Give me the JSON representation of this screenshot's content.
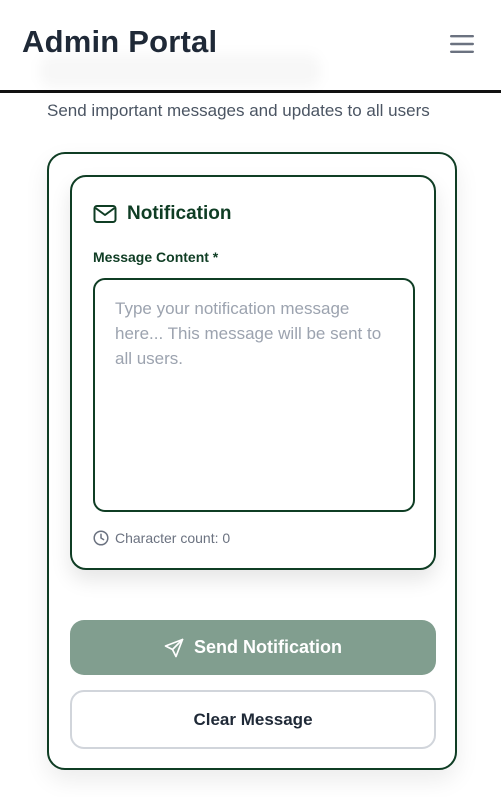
{
  "header": {
    "title": "Admin Portal",
    "menu_icon": "hamburger-menu-icon"
  },
  "page": {
    "subtitle": "Send important messages and updates to all users"
  },
  "notification_card": {
    "icon": "envelope-icon",
    "title": "Notification",
    "field_label": "Message Content *",
    "message_value": "",
    "message_placeholder": "Type your notification message here... This message will be sent to all users.",
    "char_count_icon": "clock-icon",
    "char_count_label": "Character count: 0"
  },
  "actions": {
    "send_icon": "send-icon",
    "send_label": "Send Notification",
    "clear_label": "Clear Message"
  },
  "colors": {
    "accent": "#0f3d24",
    "send_button_disabled": "#819e8f",
    "text_dark": "#1f2937",
    "muted": "#6b7280"
  }
}
